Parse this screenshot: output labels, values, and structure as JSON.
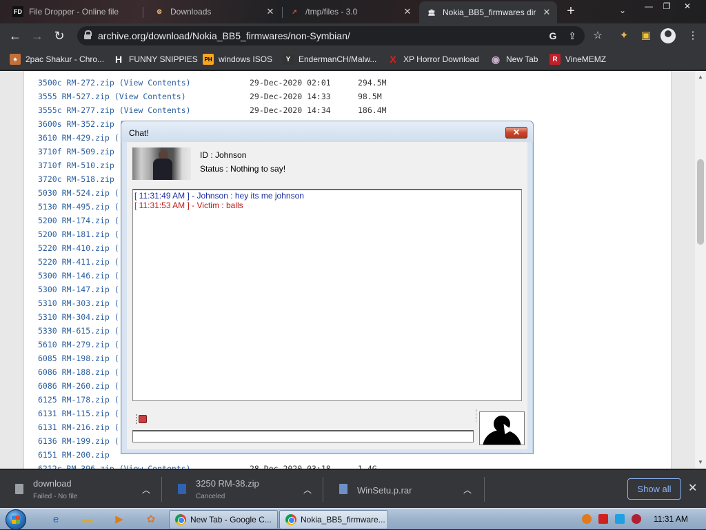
{
  "browser": {
    "tabs": [
      {
        "label": "File Dropper - Online file",
        "favicon": "FD"
      },
      {
        "label": "Downloads",
        "favicon": "⚙"
      },
      {
        "label": "/tmp/files - 3.0",
        "favicon": "↗"
      },
      {
        "label": "Nokia_BB5_firmwares dir",
        "favicon": "🏛"
      }
    ],
    "new_tab": "+",
    "url_host": "archive.org",
    "url_path": "/download/Nokia_BB5_firmwares/non-Symbian/",
    "bookmarks": [
      {
        "label": "2pac Shakur - Chro...",
        "icon": "♠",
        "color": "#c2703a"
      },
      {
        "label": "FUNNY SNIPPIES",
        "icon": "H",
        "color": "#ffffff"
      },
      {
        "label": "windows ISOS",
        "icon": "PH",
        "color": "#f5a623"
      },
      {
        "label": "EndermanCH/Malw...",
        "icon": "Y",
        "color": "#ffffff"
      },
      {
        "label": "XP Horror Download",
        "icon": "X",
        "color": "#e02020"
      },
      {
        "label": "New Tab",
        "icon": "◉",
        "color": "#b0a0b8"
      },
      {
        "label": "VineMEMZ",
        "icon": "R",
        "color": "#c0202a"
      }
    ]
  },
  "files": [
    {
      "name": "3500c RM-272.zip",
      "view": "(View Contents)",
      "date": "29-Dec-2020 02:01",
      "size": "294.5M"
    },
    {
      "name": "3555 RM-527.zip",
      "view": "(View Contents)",
      "date": "29-Dec-2020 14:33",
      "size": "98.5M"
    },
    {
      "name": "3555c RM-277.zip",
      "view": "(View Contents)",
      "date": "29-Dec-2020 14:34",
      "size": "186.4M"
    },
    {
      "name": "3600s RM-352.zip",
      "view": "(",
      "date": "",
      "size": ""
    },
    {
      "name": "3610 RM-429.zip",
      "view": "(",
      "date": "",
      "size": ""
    },
    {
      "name": "3710f RM-509.zip",
      "view": "(",
      "date": "",
      "size": ""
    },
    {
      "name": "3710f RM-510.zip",
      "view": "(",
      "date": "",
      "size": ""
    },
    {
      "name": "3720c RM-518.zip",
      "view": "(",
      "date": "",
      "size": ""
    },
    {
      "name": "5030 RM-524.zip",
      "view": "(",
      "date": "",
      "size": ""
    },
    {
      "name": "5130 RM-495.zip",
      "view": "(",
      "date": "",
      "size": ""
    },
    {
      "name": "5200 RM-174.zip",
      "view": "(",
      "date": "",
      "size": ""
    },
    {
      "name": "5200 RM-181.zip",
      "view": "(",
      "date": "",
      "size": ""
    },
    {
      "name": "5220 RM-410.zip",
      "view": "(",
      "date": "",
      "size": ""
    },
    {
      "name": "5220 RM-411.zip",
      "view": "(",
      "date": "",
      "size": ""
    },
    {
      "name": "5300 RM-146.zip",
      "view": "(",
      "date": "",
      "size": ""
    },
    {
      "name": "5300 RM-147.zip",
      "view": "(",
      "date": "",
      "size": ""
    },
    {
      "name": "5310 RM-303.zip",
      "view": "(",
      "date": "",
      "size": ""
    },
    {
      "name": "5310 RM-304.zip",
      "view": "(",
      "date": "",
      "size": ""
    },
    {
      "name": "5330 RM-615.zip",
      "view": "(",
      "date": "",
      "size": ""
    },
    {
      "name": "5610 RM-279.zip",
      "view": "(",
      "date": "",
      "size": ""
    },
    {
      "name": "6085 RM-198.zip",
      "view": "(",
      "date": "",
      "size": ""
    },
    {
      "name": "6086 RM-188.zip",
      "view": "(",
      "date": "",
      "size": ""
    },
    {
      "name": "6086 RM-260.zip",
      "view": "(",
      "date": "",
      "size": ""
    },
    {
      "name": "6125 RM-178.zip",
      "view": "(",
      "date": "",
      "size": ""
    },
    {
      "name": "6131 RM-115.zip",
      "view": "(",
      "date": "",
      "size": ""
    },
    {
      "name": "6131 RM-216.zip",
      "view": "(",
      "date": "",
      "size": ""
    },
    {
      "name": "6136 RM-199.zip",
      "view": "(",
      "date": "",
      "size": ""
    },
    {
      "name": "6151 RM-200.zip",
      "view": "",
      "date": "",
      "size": ""
    },
    {
      "name": "6212c RM-396.zip",
      "view": "(View Contents)",
      "date": "28-Dec-2020 03:18",
      "size": "1.4G"
    }
  ],
  "chat": {
    "title": "Chat!",
    "close_glyph": "✕",
    "id_text": "ID : Johnson",
    "status_text": "Status : Nothing to say!",
    "messages": [
      {
        "text": "[ 11:31:49 AM ] - Johnson : hey its me johnson",
        "color": "blue"
      },
      {
        "text": "[ 11:31:53 AM ] - Victim : balls",
        "color": "red"
      }
    ],
    "input_value": ""
  },
  "downloads": [
    {
      "name": "download",
      "status": "Failed - No file"
    },
    {
      "name": "3250 RM-38.zip",
      "status": "Canceled"
    },
    {
      "name": "WinSetu.p.rar",
      "status": ""
    }
  ],
  "show_all_label": "Show all",
  "taskbar": {
    "tasks": [
      "New Tab - Google C...",
      "Nokia_BB5_firmware..."
    ],
    "clock": "11:31 AM"
  }
}
